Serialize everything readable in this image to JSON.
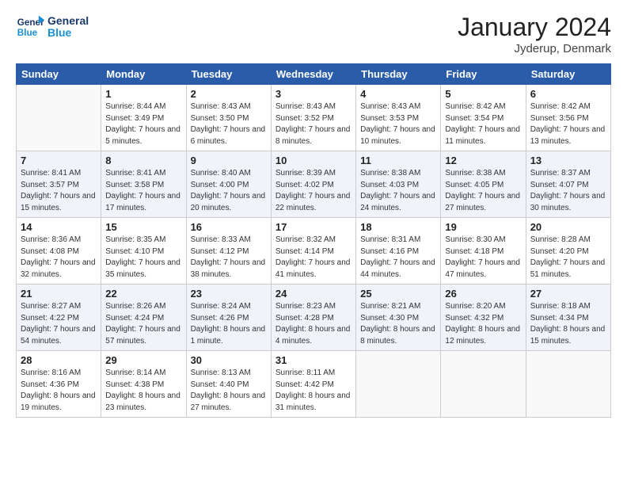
{
  "header": {
    "logo_general": "General",
    "logo_blue": "Blue",
    "title": "January 2024",
    "subtitle": "Jyderup, Denmark"
  },
  "weekdays": [
    "Sunday",
    "Monday",
    "Tuesday",
    "Wednesday",
    "Thursday",
    "Friday",
    "Saturday"
  ],
  "weeks": [
    [
      {
        "day": "",
        "sunrise": "",
        "sunset": "",
        "daylight": "",
        "empty": true
      },
      {
        "day": "1",
        "sunrise": "Sunrise: 8:44 AM",
        "sunset": "Sunset: 3:49 PM",
        "daylight": "Daylight: 7 hours and 5 minutes."
      },
      {
        "day": "2",
        "sunrise": "Sunrise: 8:43 AM",
        "sunset": "Sunset: 3:50 PM",
        "daylight": "Daylight: 7 hours and 6 minutes."
      },
      {
        "day": "3",
        "sunrise": "Sunrise: 8:43 AM",
        "sunset": "Sunset: 3:52 PM",
        "daylight": "Daylight: 7 hours and 8 minutes."
      },
      {
        "day": "4",
        "sunrise": "Sunrise: 8:43 AM",
        "sunset": "Sunset: 3:53 PM",
        "daylight": "Daylight: 7 hours and 10 minutes."
      },
      {
        "day": "5",
        "sunrise": "Sunrise: 8:42 AM",
        "sunset": "Sunset: 3:54 PM",
        "daylight": "Daylight: 7 hours and 11 minutes."
      },
      {
        "day": "6",
        "sunrise": "Sunrise: 8:42 AM",
        "sunset": "Sunset: 3:56 PM",
        "daylight": "Daylight: 7 hours and 13 minutes."
      }
    ],
    [
      {
        "day": "7",
        "sunrise": "Sunrise: 8:41 AM",
        "sunset": "Sunset: 3:57 PM",
        "daylight": "Daylight: 7 hours and 15 minutes."
      },
      {
        "day": "8",
        "sunrise": "Sunrise: 8:41 AM",
        "sunset": "Sunset: 3:58 PM",
        "daylight": "Daylight: 7 hours and 17 minutes."
      },
      {
        "day": "9",
        "sunrise": "Sunrise: 8:40 AM",
        "sunset": "Sunset: 4:00 PM",
        "daylight": "Daylight: 7 hours and 20 minutes."
      },
      {
        "day": "10",
        "sunrise": "Sunrise: 8:39 AM",
        "sunset": "Sunset: 4:02 PM",
        "daylight": "Daylight: 7 hours and 22 minutes."
      },
      {
        "day": "11",
        "sunrise": "Sunrise: 8:38 AM",
        "sunset": "Sunset: 4:03 PM",
        "daylight": "Daylight: 7 hours and 24 minutes."
      },
      {
        "day": "12",
        "sunrise": "Sunrise: 8:38 AM",
        "sunset": "Sunset: 4:05 PM",
        "daylight": "Daylight: 7 hours and 27 minutes."
      },
      {
        "day": "13",
        "sunrise": "Sunrise: 8:37 AM",
        "sunset": "Sunset: 4:07 PM",
        "daylight": "Daylight: 7 hours and 30 minutes."
      }
    ],
    [
      {
        "day": "14",
        "sunrise": "Sunrise: 8:36 AM",
        "sunset": "Sunset: 4:08 PM",
        "daylight": "Daylight: 7 hours and 32 minutes."
      },
      {
        "day": "15",
        "sunrise": "Sunrise: 8:35 AM",
        "sunset": "Sunset: 4:10 PM",
        "daylight": "Daylight: 7 hours and 35 minutes."
      },
      {
        "day": "16",
        "sunrise": "Sunrise: 8:33 AM",
        "sunset": "Sunset: 4:12 PM",
        "daylight": "Daylight: 7 hours and 38 minutes."
      },
      {
        "day": "17",
        "sunrise": "Sunrise: 8:32 AM",
        "sunset": "Sunset: 4:14 PM",
        "daylight": "Daylight: 7 hours and 41 minutes."
      },
      {
        "day": "18",
        "sunrise": "Sunrise: 8:31 AM",
        "sunset": "Sunset: 4:16 PM",
        "daylight": "Daylight: 7 hours and 44 minutes."
      },
      {
        "day": "19",
        "sunrise": "Sunrise: 8:30 AM",
        "sunset": "Sunset: 4:18 PM",
        "daylight": "Daylight: 7 hours and 47 minutes."
      },
      {
        "day": "20",
        "sunrise": "Sunrise: 8:28 AM",
        "sunset": "Sunset: 4:20 PM",
        "daylight": "Daylight: 7 hours and 51 minutes."
      }
    ],
    [
      {
        "day": "21",
        "sunrise": "Sunrise: 8:27 AM",
        "sunset": "Sunset: 4:22 PM",
        "daylight": "Daylight: 7 hours and 54 minutes."
      },
      {
        "day": "22",
        "sunrise": "Sunrise: 8:26 AM",
        "sunset": "Sunset: 4:24 PM",
        "daylight": "Daylight: 7 hours and 57 minutes."
      },
      {
        "day": "23",
        "sunrise": "Sunrise: 8:24 AM",
        "sunset": "Sunset: 4:26 PM",
        "daylight": "Daylight: 8 hours and 1 minute."
      },
      {
        "day": "24",
        "sunrise": "Sunrise: 8:23 AM",
        "sunset": "Sunset: 4:28 PM",
        "daylight": "Daylight: 8 hours and 4 minutes."
      },
      {
        "day": "25",
        "sunrise": "Sunrise: 8:21 AM",
        "sunset": "Sunset: 4:30 PM",
        "daylight": "Daylight: 8 hours and 8 minutes."
      },
      {
        "day": "26",
        "sunrise": "Sunrise: 8:20 AM",
        "sunset": "Sunset: 4:32 PM",
        "daylight": "Daylight: 8 hours and 12 minutes."
      },
      {
        "day": "27",
        "sunrise": "Sunrise: 8:18 AM",
        "sunset": "Sunset: 4:34 PM",
        "daylight": "Daylight: 8 hours and 15 minutes."
      }
    ],
    [
      {
        "day": "28",
        "sunrise": "Sunrise: 8:16 AM",
        "sunset": "Sunset: 4:36 PM",
        "daylight": "Daylight: 8 hours and 19 minutes."
      },
      {
        "day": "29",
        "sunrise": "Sunrise: 8:14 AM",
        "sunset": "Sunset: 4:38 PM",
        "daylight": "Daylight: 8 hours and 23 minutes."
      },
      {
        "day": "30",
        "sunrise": "Sunrise: 8:13 AM",
        "sunset": "Sunset: 4:40 PM",
        "daylight": "Daylight: 8 hours and 27 minutes."
      },
      {
        "day": "31",
        "sunrise": "Sunrise: 8:11 AM",
        "sunset": "Sunset: 4:42 PM",
        "daylight": "Daylight: 8 hours and 31 minutes."
      },
      {
        "day": "",
        "sunrise": "",
        "sunset": "",
        "daylight": "",
        "empty": true
      },
      {
        "day": "",
        "sunrise": "",
        "sunset": "",
        "daylight": "",
        "empty": true
      },
      {
        "day": "",
        "sunrise": "",
        "sunset": "",
        "daylight": "",
        "empty": true
      }
    ]
  ]
}
